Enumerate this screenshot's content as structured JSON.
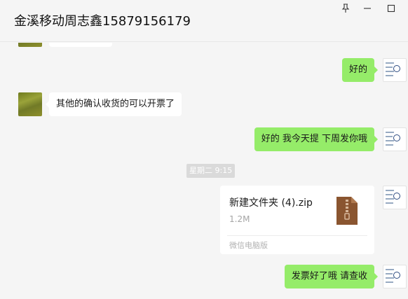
{
  "window": {
    "title": "金溪移动周志鑫15879156179",
    "buttons": {
      "pin": "pin-icon",
      "minimize": "minimize-icon",
      "maximize": "maximize-icon"
    }
  },
  "messages": [
    {
      "side": "right",
      "text": "好的"
    },
    {
      "side": "left",
      "text": "其他的确认收货的可以开票了"
    },
    {
      "side": "right",
      "text": "好的 我今天提 下周发你哦"
    },
    {
      "type": "time",
      "text": "星期二 9:15"
    },
    {
      "side": "right",
      "type": "file",
      "name": "新建文件夹 (4).zip",
      "size": "1.2M",
      "source": "微信电脑版"
    },
    {
      "side": "right",
      "text": "发票好了哦 请查收"
    }
  ],
  "colors": {
    "bubble_self": "#95ec69",
    "bubble_other": "#ffffff",
    "background": "#f5f5f5",
    "zip_icon": "#8a5530"
  }
}
